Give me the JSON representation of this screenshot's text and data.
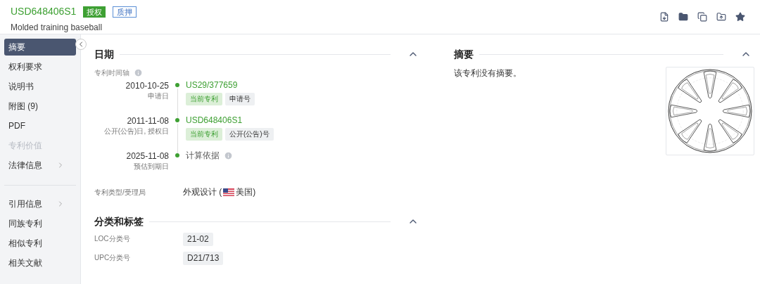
{
  "header": {
    "patent_number": "USD648406S1",
    "badges": [
      {
        "label": "授权",
        "kind": "solid"
      },
      {
        "label": "质押",
        "kind": "outline"
      }
    ],
    "title": "Molded training baseball"
  },
  "sidebar": {
    "groups": [
      {
        "items": [
          {
            "label": "摘要",
            "selected": true,
            "disabled": false,
            "expandable": false
          },
          {
            "label": "权利要求",
            "selected": false,
            "disabled": false,
            "expandable": false
          },
          {
            "label": "说明书",
            "selected": false,
            "disabled": false,
            "expandable": false
          },
          {
            "label": "附图 (9)",
            "selected": false,
            "disabled": false,
            "expandable": false
          },
          {
            "label": "PDF",
            "selected": false,
            "disabled": false,
            "expandable": false
          },
          {
            "label": "专利价值",
            "selected": false,
            "disabled": true,
            "expandable": false
          },
          {
            "label": "法律信息",
            "selected": false,
            "disabled": false,
            "expandable": true
          }
        ]
      },
      {
        "items": [
          {
            "label": "引用信息",
            "selected": false,
            "disabled": false,
            "expandable": true
          },
          {
            "label": "同族专利",
            "selected": false,
            "disabled": false,
            "expandable": false
          },
          {
            "label": "相似专利",
            "selected": false,
            "disabled": false,
            "expandable": false
          },
          {
            "label": "相关文献",
            "selected": false,
            "disabled": false,
            "expandable": false
          }
        ]
      }
    ]
  },
  "dates": {
    "title": "日期",
    "expanded": true,
    "timeline_label": "专利时间轴",
    "events": [
      {
        "date": "2010-10-25",
        "label": "申请日",
        "kind": "number",
        "text": "US29/377659",
        "tags": [
          {
            "label": "当前专利",
            "kind": "current"
          },
          {
            "label": "申请号",
            "kind": "plain"
          }
        ]
      },
      {
        "date": "2011-11-08",
        "label": "公开(公告)日, 授权日",
        "kind": "number",
        "text": "USD648406S1",
        "tags": [
          {
            "label": "当前专利",
            "kind": "current"
          },
          {
            "label": "公开(公告)号",
            "kind": "plain"
          }
        ]
      },
      {
        "date": "2025-11-08",
        "label": "预估到期日",
        "kind": "basis",
        "text": "计算依据"
      }
    ],
    "type_label": "专利类型/受理局",
    "type_value": "外观设计 (",
    "office": "美国)"
  },
  "classification": {
    "title": "分类和标签",
    "expanded": true,
    "rows": [
      {
        "label": "LOC分类号",
        "value": "21-02"
      },
      {
        "label": "UPC分类号",
        "value": "D21/713"
      }
    ]
  },
  "abstract": {
    "title": "摘要",
    "expanded": true,
    "text": "该专利没有摘要。"
  }
}
